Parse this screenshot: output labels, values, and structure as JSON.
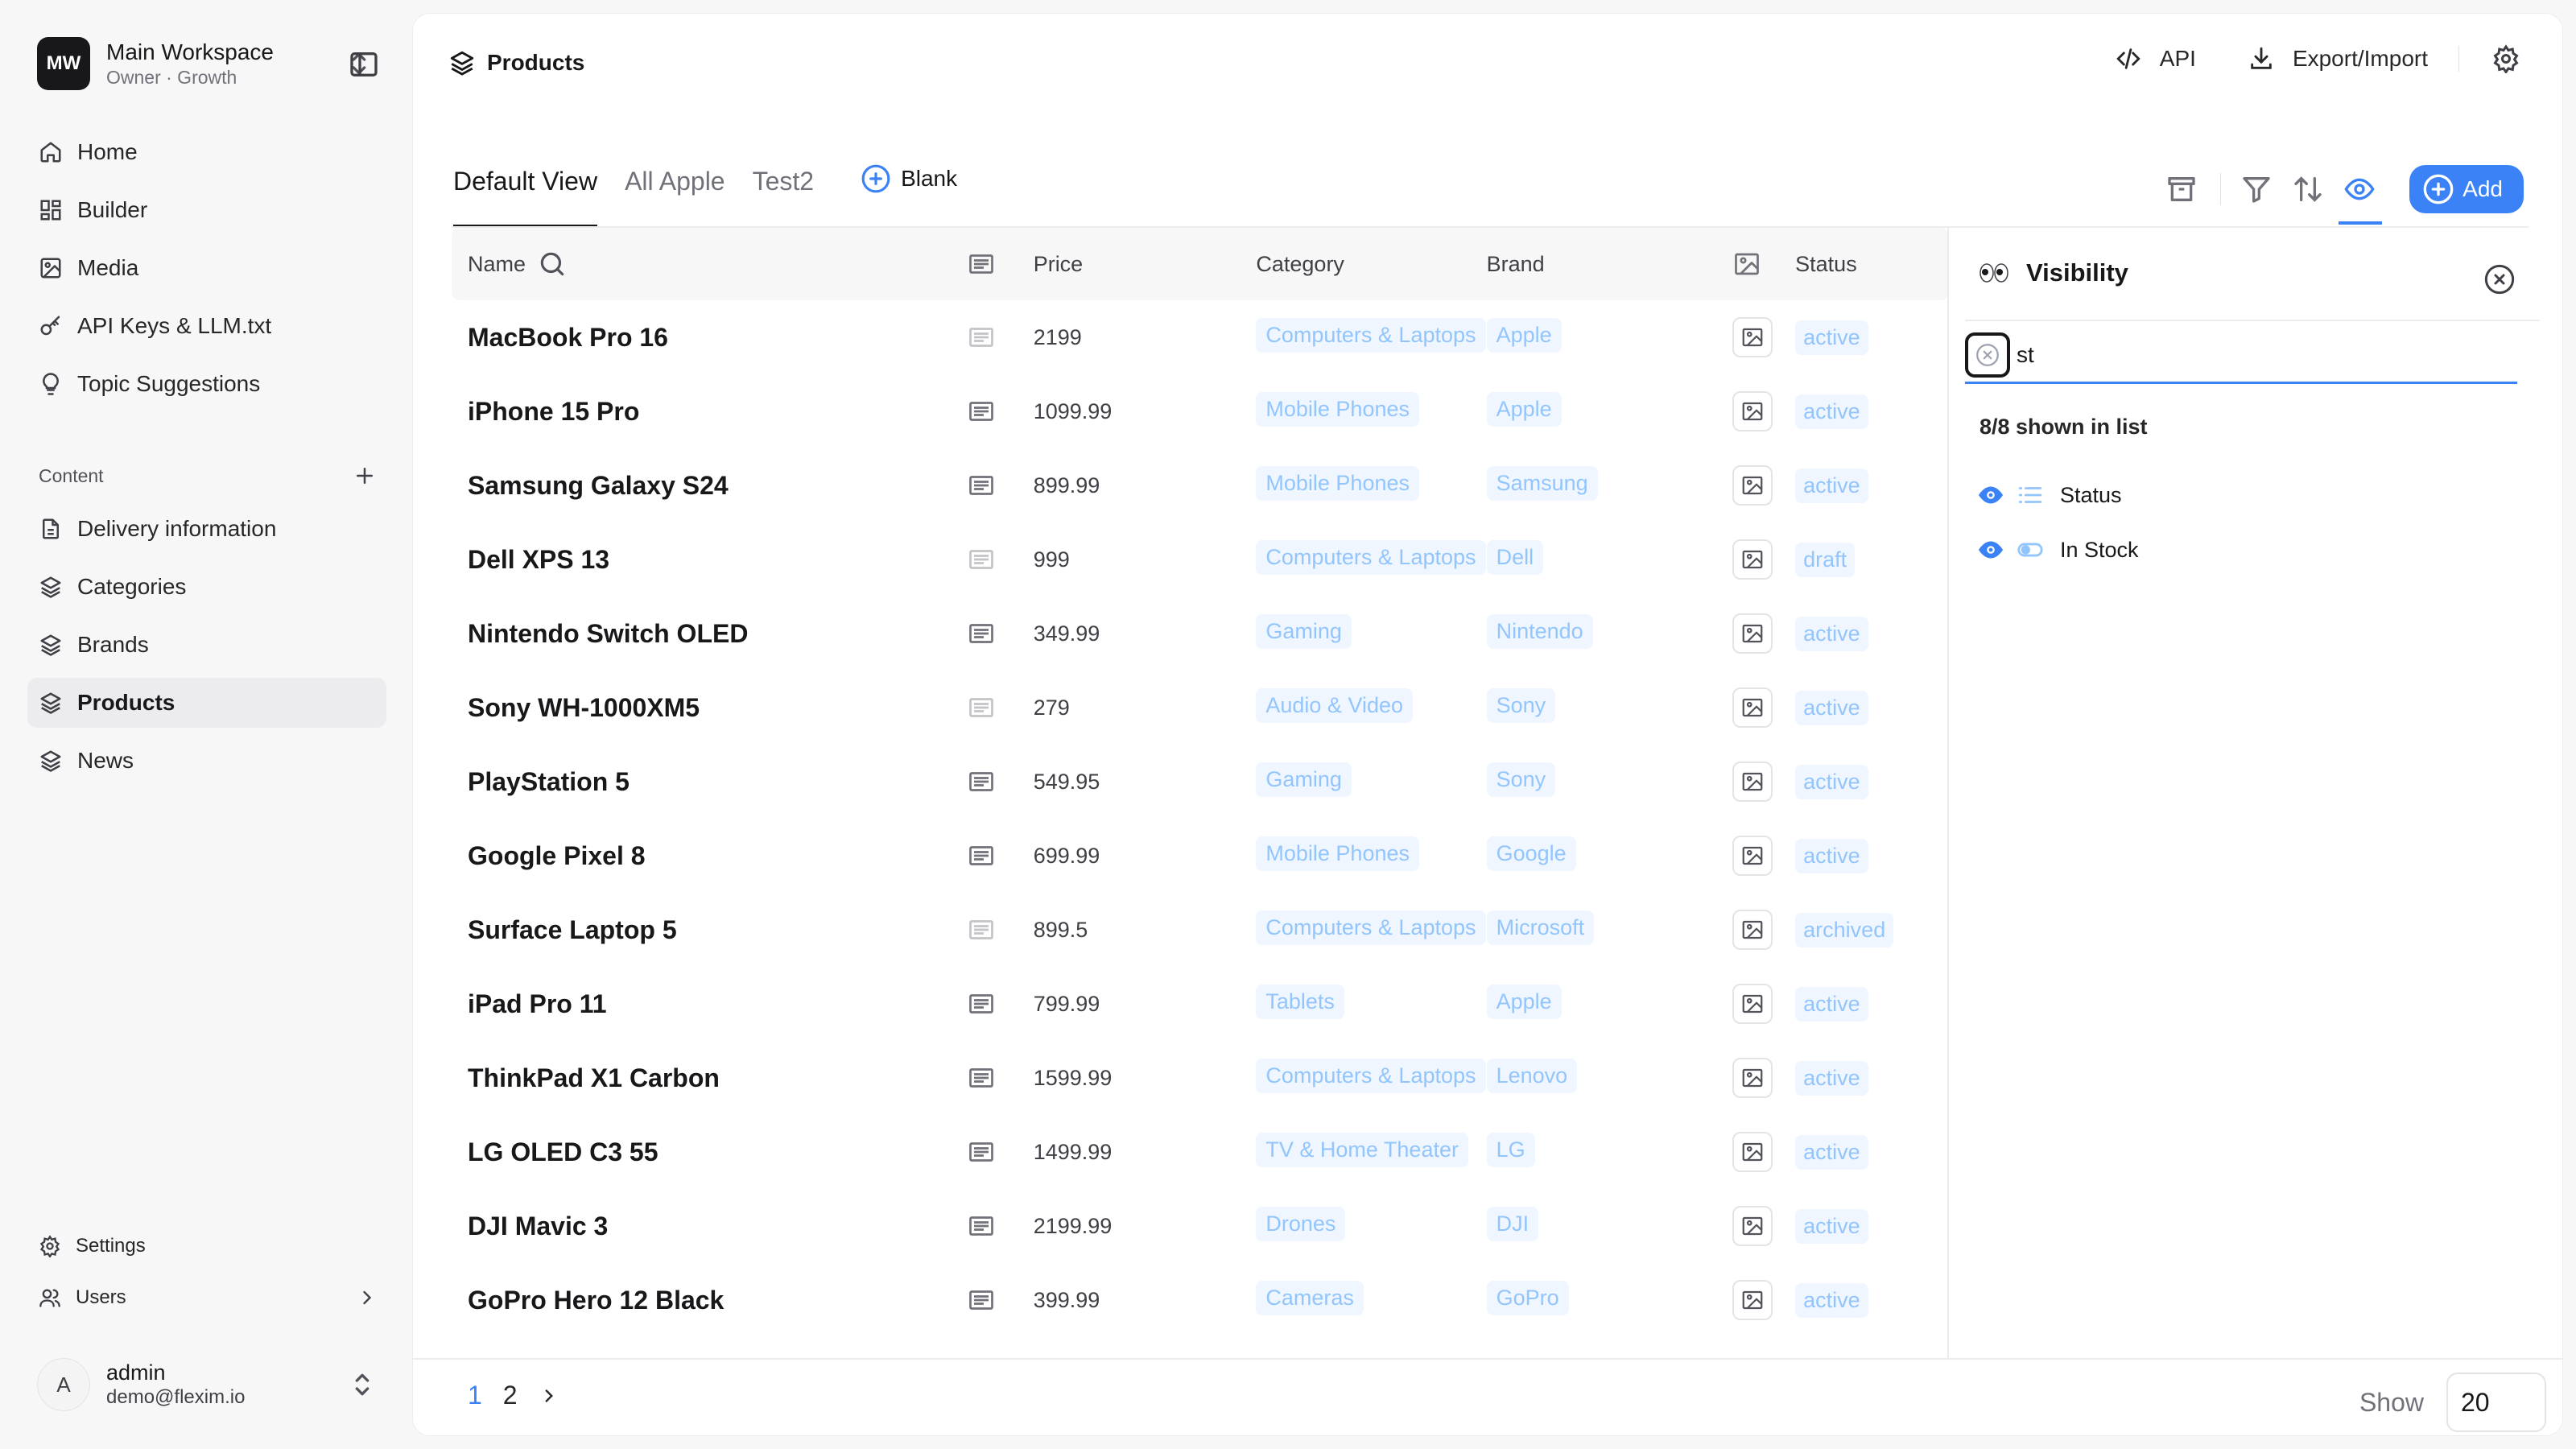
{
  "workspace": {
    "initials": "MW",
    "name": "Main Workspace",
    "subtitle": "Owner · Growth"
  },
  "nav": [
    {
      "label": "Home",
      "icon": "home-icon"
    },
    {
      "label": "Builder",
      "icon": "grid-icon"
    },
    {
      "label": "Media",
      "icon": "image-icon"
    },
    {
      "label": "API Keys & LLM.txt",
      "icon": "key-icon"
    },
    {
      "label": "Topic Suggestions",
      "icon": "lightbulb-icon"
    }
  ],
  "content_section": {
    "label": "Content",
    "items": [
      {
        "label": "Delivery information",
        "icon": "document-icon",
        "active": false
      },
      {
        "label": "Categories",
        "icon": "layers-icon",
        "active": false
      },
      {
        "label": "Brands",
        "icon": "layers-icon",
        "active": false
      },
      {
        "label": "Products",
        "icon": "layers-icon",
        "active": true
      },
      {
        "label": "News",
        "icon": "layers-icon",
        "active": false
      }
    ]
  },
  "bottom_nav": {
    "settings": "Settings",
    "users": "Users"
  },
  "user": {
    "initial": "A",
    "name": "admin",
    "email": "demo@flexim.io"
  },
  "page": {
    "title": "Products"
  },
  "top_actions": {
    "api": "API",
    "export_import": "Export/Import"
  },
  "tabs": [
    {
      "label": "Default View",
      "active": true
    },
    {
      "label": "All Apple",
      "active": false
    },
    {
      "label": "Test2",
      "active": false
    }
  ],
  "blank_tab": "Blank",
  "add_button": "Add",
  "columns": {
    "name": "Name",
    "price": "Price",
    "category": "Category",
    "brand": "Brand",
    "status": "Status"
  },
  "rows": [
    {
      "name": "MacBook Pro 16",
      "price": "2199",
      "category": "Computers & Laptops",
      "brand": "Apple",
      "status": "active",
      "desc_light": true
    },
    {
      "name": "iPhone 15 Pro",
      "price": "1099.99",
      "category": "Mobile Phones",
      "brand": "Apple",
      "status": "active",
      "desc_light": false
    },
    {
      "name": "Samsung Galaxy S24",
      "price": "899.99",
      "category": "Mobile Phones",
      "brand": "Samsung",
      "status": "active",
      "desc_light": false
    },
    {
      "name": "Dell XPS 13",
      "price": "999",
      "category": "Computers & Laptops",
      "brand": "Dell",
      "status": "draft",
      "desc_light": true
    },
    {
      "name": "Nintendo Switch OLED",
      "price": "349.99",
      "category": "Gaming",
      "brand": "Nintendo",
      "status": "active",
      "desc_light": false
    },
    {
      "name": "Sony WH-1000XM5",
      "price": "279",
      "category": "Audio & Video",
      "brand": "Sony",
      "status": "active",
      "desc_light": true
    },
    {
      "name": "PlayStation 5",
      "price": "549.95",
      "category": "Gaming",
      "brand": "Sony",
      "status": "active",
      "desc_light": false
    },
    {
      "name": "Google Pixel 8",
      "price": "699.99",
      "category": "Mobile Phones",
      "brand": "Google",
      "status": "active",
      "desc_light": false
    },
    {
      "name": "Surface Laptop 5",
      "price": "899.5",
      "category": "Computers & Laptops",
      "brand": "Microsoft",
      "status": "archived",
      "desc_light": true
    },
    {
      "name": "iPad Pro 11",
      "price": "799.99",
      "category": "Tablets",
      "brand": "Apple",
      "status": "active",
      "desc_light": false
    },
    {
      "name": "ThinkPad X1 Carbon",
      "price": "1599.99",
      "category": "Computers & Laptops",
      "brand": "Lenovo",
      "status": "active",
      "desc_light": false
    },
    {
      "name": "LG OLED C3 55",
      "price": "1499.99",
      "category": "TV & Home Theater",
      "brand": "LG",
      "status": "active",
      "desc_light": false
    },
    {
      "name": "DJI Mavic 3",
      "price": "2199.99",
      "category": "Drones",
      "brand": "DJI",
      "status": "active",
      "desc_light": false
    },
    {
      "name": "GoPro Hero 12 Black",
      "price": "399.99",
      "category": "Cameras",
      "brand": "GoPro",
      "status": "active",
      "desc_light": false
    }
  ],
  "pagination": {
    "pages": [
      "1",
      "2"
    ],
    "current": "1",
    "show_label": "Show",
    "page_size": "20"
  },
  "visibility_panel": {
    "title": "Visibility",
    "search_value": "st",
    "count_text": "8/8 shown in list",
    "items": [
      {
        "label": "Status",
        "type_icon": "list-icon"
      },
      {
        "label": "In Stock",
        "type_icon": "toggle-icon"
      }
    ]
  },
  "colors": {
    "accent": "#3b82f6",
    "chip_bg": "#eff6ff",
    "chip_text": "#93c5fd"
  }
}
